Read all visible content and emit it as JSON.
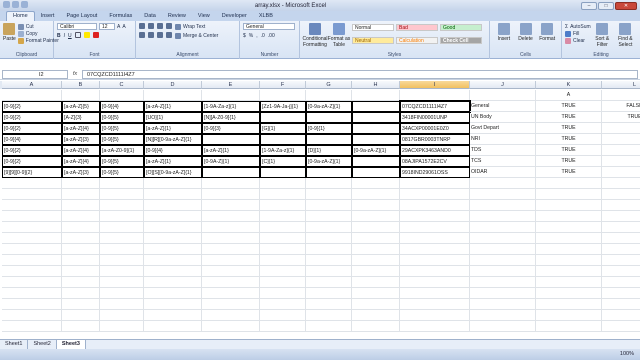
{
  "window": {
    "title": "array.xlsx - Microsoft Excel"
  },
  "tabs": [
    "Home",
    "Insert",
    "Page Layout",
    "Formulas",
    "Data",
    "Review",
    "View",
    "Developer",
    "XLBB"
  ],
  "ribbon": {
    "clipboard": {
      "paste": "Paste",
      "cut": "Cut",
      "copy": "Copy",
      "format_painter": "Format Painter",
      "label": "Clipboard"
    },
    "font": {
      "name": "Calibri",
      "size": "12",
      "label": "Font"
    },
    "alignment": {
      "wrap": "Wrap Text",
      "merge": "Merge & Center",
      "label": "Alignment"
    },
    "number": {
      "format": "General",
      "label": "Number"
    },
    "styles": {
      "conditional": "Conditional Formatting",
      "format_table": "Format as Table",
      "normal": "Normal",
      "bad": "Bad",
      "good": "Good",
      "neutral": "Neutral",
      "calculation": "Calculation",
      "check": "Check Cell",
      "label": "Styles"
    },
    "cells": {
      "insert": "Insert",
      "delete": "Delete",
      "format": "Format",
      "label": "Cells"
    },
    "editing": {
      "autosum": "AutoSum",
      "fill": "Fill",
      "clear": "Clear",
      "sort": "Sort & Filter",
      "find": "Find & Select",
      "label": "Editing"
    }
  },
  "formula_bar": {
    "name_box": "I2",
    "fx": "fx",
    "value": "07CQZCD1111I4Z7"
  },
  "columns": [
    "A",
    "B",
    "C",
    "D",
    "E",
    "F",
    "G",
    "H",
    "I",
    "J",
    "K",
    "L"
  ],
  "rows": [
    {
      "A": "",
      "B": "",
      "C": "",
      "D": "",
      "E": "",
      "F": "",
      "G": "",
      "H": "",
      "I": "",
      "J": "",
      "K": "A",
      "L": ""
    },
    {
      "A": "[0-9]{2}",
      "B": "[a-zA-Z]{5}",
      "C": "[0-9]{4}",
      "D": "[a-zA-Z]{1}",
      "E": "[1-9A-Za-z]{1}",
      "F": "[Zz1-9A-Ja-j]{1}",
      "G": "[0-9a-zA-Z]{1}",
      "H": "",
      "I": "07CQZCD1111I4Z7",
      "J": "General",
      "K": "TRUE",
      "L": "FALSE"
    },
    {
      "A": "[0-9]{2}",
      "B": "[A-Z]{3}",
      "C": "[0-9]{5}",
      "D": "[UO]{1}",
      "E": "[N][A-Z0-9]{1}",
      "F": "",
      "G": "",
      "H": "",
      "I": "3418FIN00001UNP",
      "J": "UN Body",
      "K": "TRUE",
      "L": "TRUE"
    },
    {
      "A": "[0-9]{2}",
      "B": "[a-zA-Z]{4}",
      "C": "[0-9]{5}",
      "D": "[a-zA-Z]{1}",
      "E": "[0-9]{3}",
      "F": "[G]{1}",
      "G": "[0-9]{1}",
      "H": "",
      "I": "34ACXP00001E0Z0",
      "J": "Govt Depart",
      "K": "TRUE",
      "L": ""
    },
    {
      "A": "[0-9]{4}",
      "B": "[a-zA-Z]{3}",
      "C": "[0-9]{5}",
      "D": "[N][R][0-9a-zA-Z]{1}",
      "E": "",
      "F": "",
      "G": "",
      "H": "",
      "I": "0817GBR0003TNRP",
      "J": "NRI",
      "K": "TRUE",
      "L": ""
    },
    {
      "A": "[0-9]{2}",
      "B": "[a-zA-Z]{4}",
      "C": "[a-zA-Z0-9]{1}",
      "D": "[0-9]{4}",
      "E": "[a-zA-Z]{1}",
      "F": "[1-9A-Za-z]{1}",
      "G": "[D]{1}",
      "H": "[0-9a-zA-Z]{1}",
      "I": "29ACXPK3463AND0",
      "J": "TDS",
      "K": "TRUE",
      "L": ""
    },
    {
      "A": "[0-9]{2}",
      "B": "[a-zA-Z]{4}",
      "C": "[0-9]{5}",
      "D": "[a-zA-Z]{1}",
      "E": "[0-9A-Z]{1}",
      "F": "[C]{1}",
      "G": "[0-9a-zA-Z]{1}",
      "H": "",
      "I": "08AJIPA1572E2CV",
      "J": "TCS",
      "K": "TRUE",
      "L": ""
    },
    {
      "A": "[9][9][0-9]{2}",
      "B": "[a-zA-Z]{3}",
      "C": "[0-9]{5}",
      "D": "[O][S][0-9a-zA-Z]{1}",
      "E": "",
      "F": "",
      "G": "",
      "H": "",
      "I": "9918IND29061OSS",
      "J": "OIDAR",
      "K": "TRUE",
      "L": ""
    }
  ],
  "sheets": [
    "Sheet1",
    "Sheet2",
    "Sheet3"
  ],
  "status": {
    "left": "",
    "zoom": "100%"
  }
}
